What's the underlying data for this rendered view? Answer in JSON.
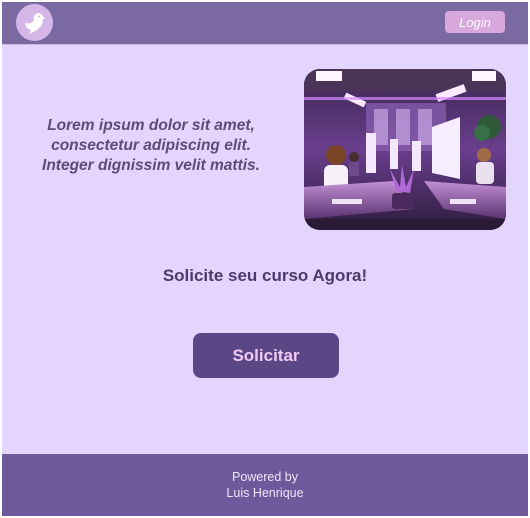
{
  "header": {
    "logo_icon": "bird-icon",
    "login_label": "Login"
  },
  "main": {
    "intro_lines": [
      "Lorem ipsum dolor sit amet,",
      "consectetur adipiscing elit.",
      "Integer dignissim velit mattis."
    ],
    "hero_image": "office-workspace-illustration",
    "cta_heading": "Solicite seu curso Agora!",
    "cta_button_label": "Solicitar"
  },
  "footer": {
    "line1": "Powered by",
    "line2": "Luis Henrique"
  },
  "colors": {
    "background": "#e3d5fe",
    "header": "#7b6aa2",
    "footer": "#6e5a9a",
    "primary_button": "#5b4786",
    "login_button": "#d7a7dd"
  }
}
